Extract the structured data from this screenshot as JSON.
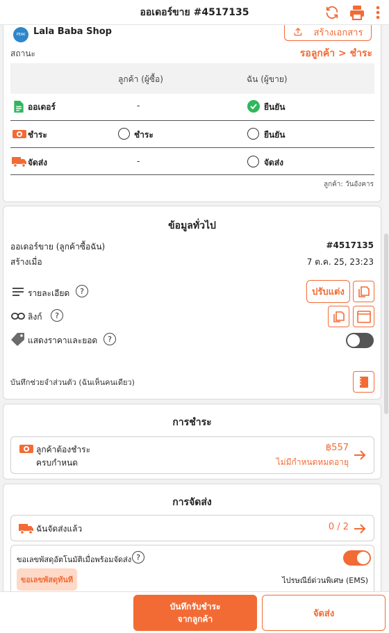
{
  "header": {
    "title": "ออเดอร์ขาย #4517135"
  },
  "shop": {
    "name": "Lala Baba Shop",
    "logo_text": "PEAK",
    "create_doc_label": "สร้างเอกสาร"
  },
  "status": {
    "label": "สถานะ",
    "value": "รอลูกค้า > ชำระ",
    "col_buyer": "ลูกค้า (ผู้ซื้อ)",
    "col_seller": "ฉัน (ผู้ขาย)",
    "rows": [
      {
        "label": "ออเดอร์",
        "buyer": "-",
        "seller": "ยืนยัน"
      },
      {
        "label": "ชำระ",
        "buyer": "ชำระ",
        "seller": "ยืนยัน"
      },
      {
        "label": "จัดส่ง",
        "buyer": "-",
        "seller": "จัดส่ง"
      }
    ],
    "footnote": "ลูกค้า: วันอังคาร"
  },
  "general": {
    "title": "ข้อมูลทั่วไป",
    "order_type_label": "ออเดอร์ขาย (ลูกค้าซื้อฉัน)",
    "order_number": "#4517135",
    "created_label": "สร้างเมื่อ",
    "created_value": "7 ต.ค. 25, 23:23",
    "details_label": "รายละเอียด",
    "customize_label": "ปรับแต่ง",
    "link_label": "ลิงก์",
    "show_price_label": "แสดงราคาและยอด",
    "show_price_on": false,
    "private_note_label": "บันทึกช่วยจำส่วนตัว (ฉันเห็นคนเดียว)"
  },
  "payment": {
    "title": "การชำระ",
    "customer_must_pay": "ลูกค้าต้องชำระ",
    "due_label": "ครบกำหนด",
    "amount": "฿557",
    "due_value": "ไม่มีกำหนดหมดอายุ"
  },
  "shipping": {
    "title": "การจัดส่ง",
    "shipped_label": "ฉันจัดส่งแล้ว",
    "shipped_count": "0 / 2",
    "auto_tracking_label": "ขอเลขพัสดุอัตโนมัติเมื่อพร้อมจัดส่ง",
    "auto_tracking_on": true,
    "request_now_label": "ขอเลขพัสดุทันที",
    "carrier": "ไปรษณีย์ด่วนพิเศษ (EMS)"
  },
  "bottom": {
    "record_payment_line1": "บันทึกรับชำระ",
    "record_payment_line2": "จากลูกค้า",
    "ship_label": "จัดส่ง"
  },
  "colors": {
    "accent": "#f26b35",
    "success": "#2eb85c"
  }
}
